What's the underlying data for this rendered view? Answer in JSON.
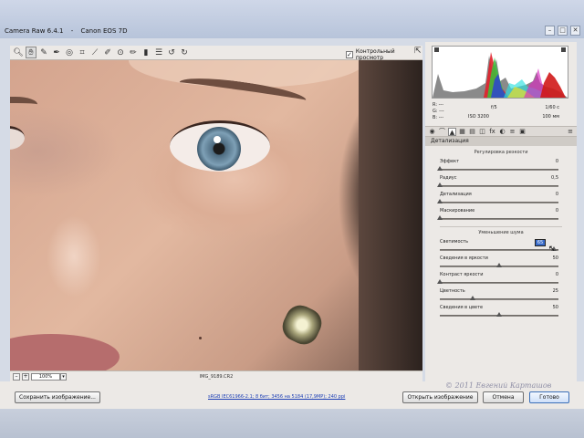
{
  "window": {
    "app_title": "Camera Raw 6.4.1",
    "separator": " - ",
    "camera": "Canon EOS 7D",
    "minimize_glyph": "–",
    "maximize_glyph": "□",
    "close_glyph": "✕"
  },
  "toolbar": {
    "tools": [
      "zoom-icon",
      "hand-icon",
      "white-balance-icon",
      "color-sampler-icon",
      "target-adjustment-icon",
      "crop-icon",
      "straighten-icon",
      "spot-removal-icon",
      "red-eye-icon",
      "adjustment-brush-icon",
      "graduated-filter-icon",
      "preferences-icon",
      "rotate-ccw-icon",
      "rotate-cw-icon"
    ],
    "preview_checked": true,
    "preview_label": "Контрольный просмотр",
    "check_glyph": "✓"
  },
  "status": {
    "zoom_minus": "–",
    "zoom_plus": "+",
    "zoom_value": "100%",
    "zoom_arrow": "▾",
    "filename": "IMG_9189.CR2"
  },
  "info": {
    "r_label": "R:",
    "r_value": "---",
    "g_label": "G:",
    "g_value": "---",
    "b_label": "B:",
    "b_value": "---",
    "aperture": "f/5",
    "shutter": "1/60 с",
    "iso": "ISO 3200",
    "focal": "100 мм"
  },
  "panel": {
    "section_title": "Детализация",
    "sharpening_title": "Регулировка резкости",
    "noise_title": "Уменьшение шума",
    "sharpening": [
      {
        "label": "Эффект",
        "value": "0",
        "pos": 0.0
      },
      {
        "label": "Радиус",
        "value": "0,5",
        "pos": 0.0
      },
      {
        "label": "Детализация",
        "value": "0",
        "pos": 0.0
      },
      {
        "label": "Маскирование",
        "value": "0",
        "pos": 0.0
      }
    ],
    "noise": [
      {
        "label": "Светимость",
        "value": "65",
        "pos": 0.96,
        "highlight": true
      },
      {
        "label": "Сведения в яркости",
        "value": "50",
        "pos": 0.5
      },
      {
        "label": "Контраст яркости",
        "value": "0",
        "pos": 0.0
      },
      {
        "label": "Цветность",
        "value": "25",
        "pos": 0.28
      },
      {
        "label": "Сведения в цвете",
        "value": "50",
        "pos": 0.5
      }
    ]
  },
  "buttons": {
    "save": "Сохранить изображение...",
    "open": "Открыть изображение",
    "cancel": "Отмена",
    "done": "Готово"
  },
  "workflow_link": "sRGB IEC61966-2.1; 8 бит; 3456 на 5184 (17,9МР); 240 ppi",
  "watermark": "© 2011 Евгений Карташов"
}
